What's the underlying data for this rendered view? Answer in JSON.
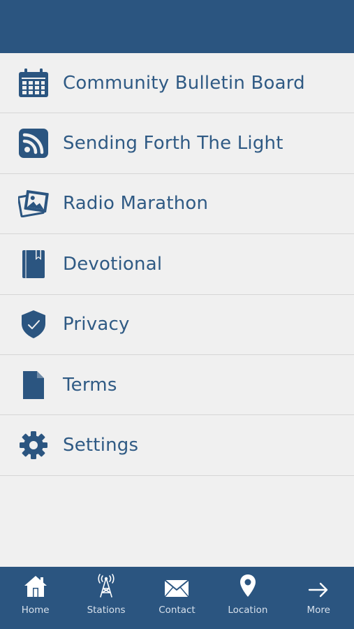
{
  "header": {},
  "menu": {
    "items": [
      {
        "label": "Community Bulletin Board",
        "icon": "calendar-icon"
      },
      {
        "label": "Sending Forth The Light",
        "icon": "rss-icon"
      },
      {
        "label": "Radio Marathon",
        "icon": "photos-icon"
      },
      {
        "label": "Devotional",
        "icon": "book-icon"
      },
      {
        "label": "Privacy",
        "icon": "shield-check-icon"
      },
      {
        "label": "Terms",
        "icon": "document-icon"
      },
      {
        "label": "Settings",
        "icon": "gear-icon"
      }
    ]
  },
  "tabbar": {
    "tabs": [
      {
        "label": "Home",
        "icon": "home-icon"
      },
      {
        "label": "Stations",
        "icon": "radio-tower-icon"
      },
      {
        "label": "Contact",
        "icon": "envelope-icon"
      },
      {
        "label": "Location",
        "icon": "map-pin-icon"
      },
      {
        "label": "More",
        "icon": "arrow-right-icon"
      }
    ]
  },
  "colors": {
    "primary": "#2b5580",
    "menu_text": "#2f5a84",
    "background": "#f0f0f0",
    "divider": "#d6d6d6",
    "tab_text": "#d7e1ec"
  }
}
